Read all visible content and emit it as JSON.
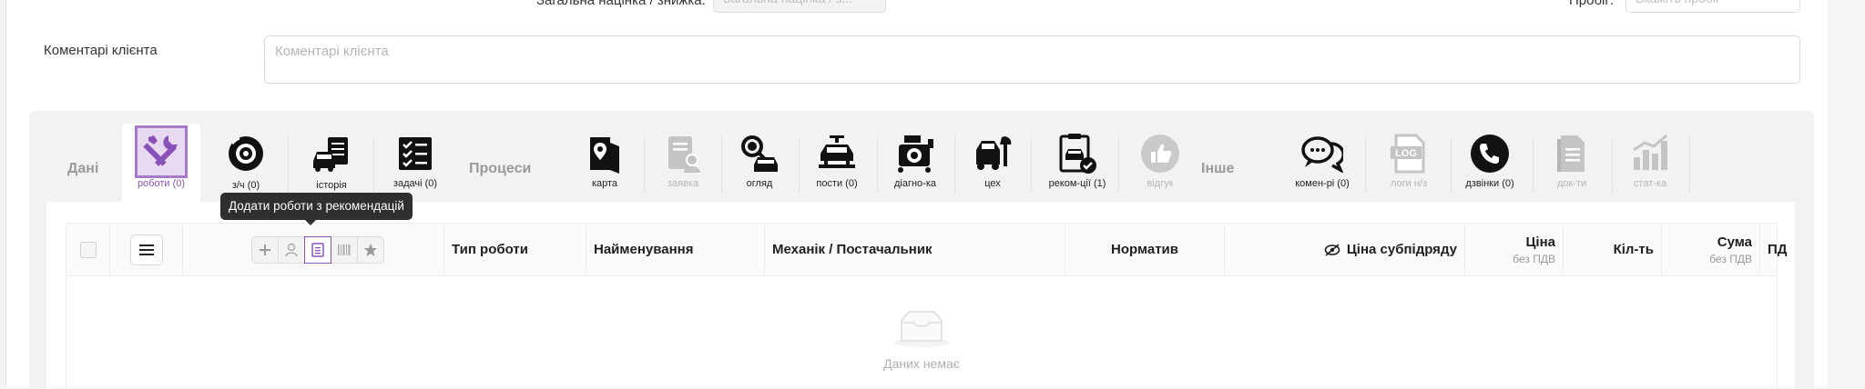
{
  "top_row": {
    "markup_label": "Загальна націнка / знижка:",
    "markup_placeholder": "Загальна націнка / з...",
    "mileage_label": "Пробіг:",
    "mileage_placeholder": "Вкажіть пробіг"
  },
  "comment": {
    "label": "Коментарі клієнта",
    "placeholder": "Коментарі клієнта"
  },
  "groups": {
    "data": "Дані",
    "processes": "Процеси",
    "other": "Інше"
  },
  "tabs": [
    {
      "label": "роботи (0)",
      "icon": "tools-icon"
    },
    {
      "label": "з/ч (0)",
      "icon": "brake-disc-icon"
    },
    {
      "label": "історія",
      "icon": "car-history-icon"
    },
    {
      "label": "задачі (0)",
      "icon": "task-list-icon"
    },
    {
      "label": "карта",
      "icon": "map-pin-icon"
    },
    {
      "label": "заявка",
      "icon": "request-icon"
    },
    {
      "label": "огляд",
      "icon": "inspection-icon"
    },
    {
      "label": "пости (0)",
      "icon": "car-lift-icon"
    },
    {
      "label": "діагно-ка",
      "icon": "diagnostics-icon"
    },
    {
      "label": "цех",
      "icon": "workshop-icon"
    },
    {
      "label": "реком-ції (1)",
      "icon": "recommendations-icon"
    },
    {
      "label": "відгук",
      "icon": "thumbs-up-icon"
    },
    {
      "label": "комен-рі (0)",
      "icon": "comments-icon"
    },
    {
      "label": "логи н/з",
      "icon": "log-icon"
    },
    {
      "label": "дзвінки (0)",
      "icon": "phone-icon"
    },
    {
      "label": "док-ти",
      "icon": "document-icon"
    },
    {
      "label": "стат-ка",
      "icon": "statistics-icon"
    }
  ],
  "table": {
    "headers": {
      "type": "Тип роботи",
      "name": "Найменування",
      "mechanic": "Механік / Постачальник",
      "norm": "Норматив",
      "subcontract": "Ціна субпідряду",
      "price": "Ціна",
      "price_sub": "без ПДВ",
      "qty": "Кіл-ть",
      "sum": "Сума",
      "sum_sub": "без ПДВ",
      "vat": "ПД"
    },
    "toolbar_tooltip": "Додати роботи з рекомендацій",
    "empty_text": "Даних немає"
  },
  "colors": {
    "accent": "#8a52b8",
    "active_tab_bg": "#ffffff",
    "panel_bg": "#f2f2f2"
  }
}
